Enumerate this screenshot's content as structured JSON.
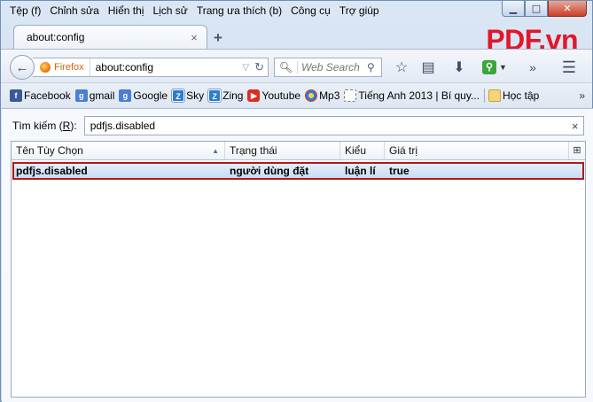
{
  "menubar": {
    "items": [
      "Tệp (f)",
      "Chỉnh sửa",
      "Hiển thị",
      "Lịch sử",
      "Trang ưa thích (b)",
      "Công cụ",
      "Trợ giúp"
    ]
  },
  "window_controls": {
    "minimize": "▁",
    "maximize": "□",
    "close": "✕"
  },
  "tab": {
    "title": "about:config",
    "close": "×",
    "new_tab": "+"
  },
  "brand": "PDF.vn",
  "navbar": {
    "back": "←",
    "identity_label": "Firefox",
    "url": "about:config",
    "search_placeholder": "Web Search",
    "icons": [
      "star-icon",
      "reading-list-icon",
      "download-icon",
      "addon-icon",
      "overflow-icon",
      "menu-icon"
    ]
  },
  "bookmarks": {
    "items": [
      {
        "label": "Facebook",
        "icon": "f"
      },
      {
        "label": "gmail",
        "icon": "g"
      },
      {
        "label": "Google",
        "icon": "g"
      },
      {
        "label": "Sky",
        "icon": "Z"
      },
      {
        "label": "Zing",
        "icon": "Z"
      },
      {
        "label": "Youtube",
        "icon": "▶"
      },
      {
        "label": "Mp3",
        "icon": ""
      },
      {
        "label": "Tiếng Anh 2013 | Bí quy...",
        "icon": ""
      },
      {
        "label": "Học tập",
        "icon": ""
      }
    ],
    "more": "»"
  },
  "config": {
    "filter_label_prefix": "Tìm kiếm (",
    "filter_label_key": "R",
    "filter_label_suffix": "):",
    "filter_value": "pdfjs.disabled",
    "clear": "×",
    "columns": [
      "Tên Tùy Chọn",
      "Trạng thái",
      "Kiểu",
      "Giá trị"
    ],
    "rows": [
      {
        "name": "pdfjs.disabled",
        "status": "người dùng đặt",
        "type": "luận lí",
        "value": "true"
      }
    ]
  }
}
